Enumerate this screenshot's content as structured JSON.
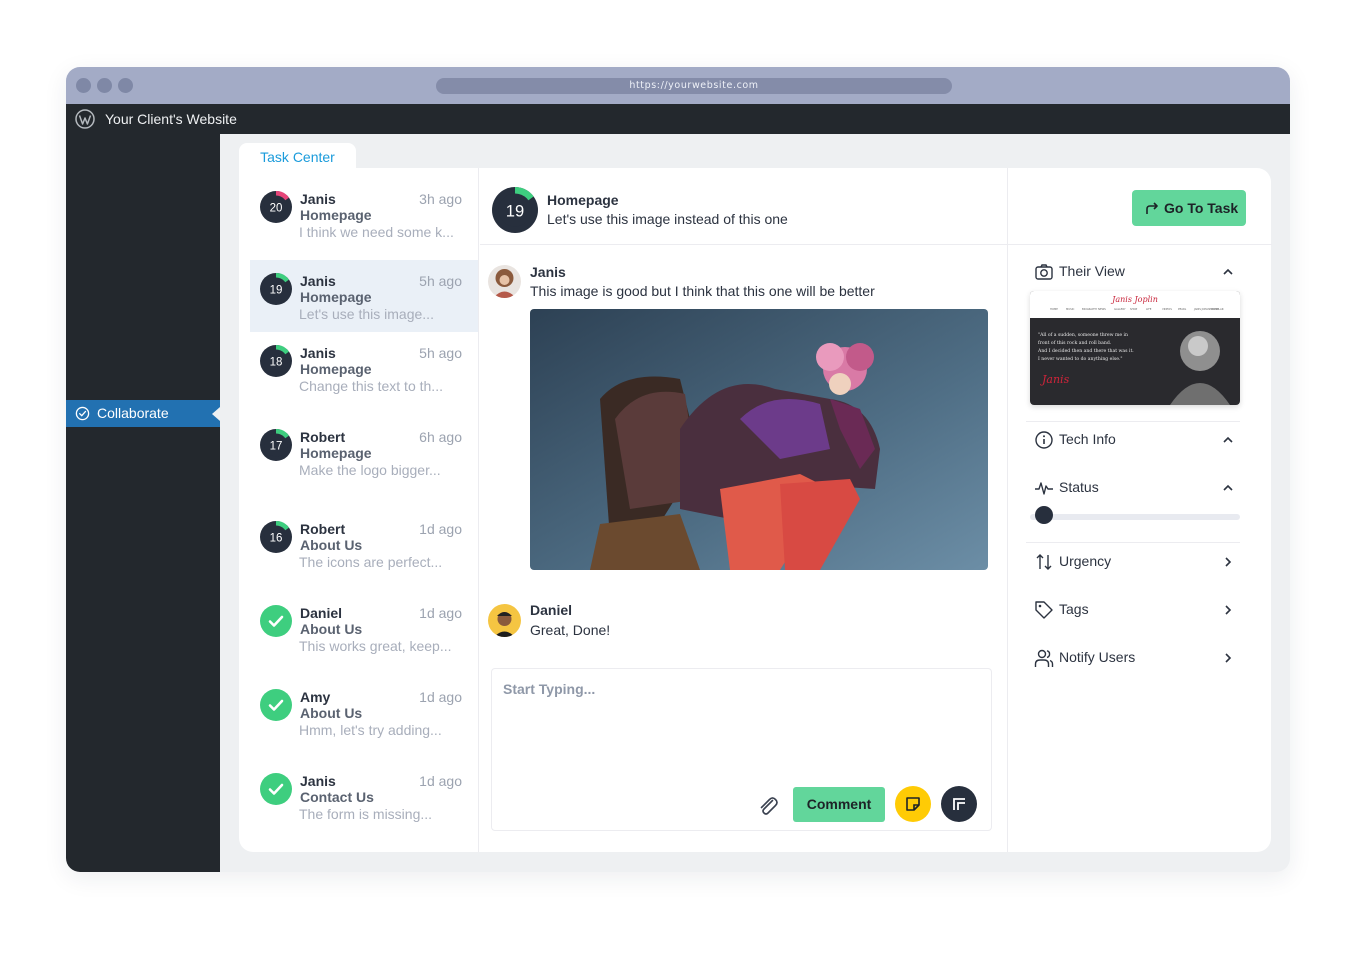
{
  "browser": {
    "url": "https://yourwebsite.com"
  },
  "wp_admin": {
    "site_name": "Your Client's Website",
    "menu_item": "Collaborate"
  },
  "tab": {
    "label": "Task Center"
  },
  "tasks": [
    {
      "number": "20",
      "name": "Janis",
      "time": "3h ago",
      "page": "Homepage",
      "excerpt": "I think we need some k...",
      "done": false,
      "progress": 0.15,
      "progress_color": "#e64579"
    },
    {
      "number": "19",
      "name": "Janis",
      "time": "5h ago",
      "page": "Homepage",
      "excerpt": "Let's use this image...",
      "done": false,
      "progress": 0.15,
      "progress_color": "#3ece7f",
      "active": true
    },
    {
      "number": "18",
      "name": "Janis",
      "time": "5h ago",
      "page": "Homepage",
      "excerpt": "Change this text to th...",
      "done": false,
      "progress": 0.15,
      "progress_color": "#3ece7f"
    },
    {
      "number": "17",
      "name": "Robert",
      "time": "6h ago",
      "page": "Homepage",
      "excerpt": "Make the logo bigger...",
      "done": false,
      "progress": 0.15,
      "progress_color": "#3ece7f"
    },
    {
      "number": "16",
      "name": "Robert",
      "time": "1d ago",
      "page": "About Us",
      "excerpt": "The icons are perfect...",
      "done": false,
      "progress": 0.15,
      "progress_color": "#3ece7f"
    },
    {
      "number": "",
      "name": "Daniel",
      "time": "1d ago",
      "page": "About Us",
      "excerpt": "This works great, keep...",
      "done": true
    },
    {
      "number": "",
      "name": "Amy",
      "time": "1d ago",
      "page": "About Us",
      "excerpt": "Hmm, let's try adding...",
      "done": true
    },
    {
      "number": "",
      "name": "Janis",
      "time": "1d ago",
      "page": "Contact Us",
      "excerpt": "The form is missing...",
      "done": true
    }
  ],
  "current_task": {
    "number": "19",
    "page": "Homepage",
    "title": "Let's use this image instead of this one",
    "go_button": "Go To Task"
  },
  "messages": [
    {
      "author": "Janis",
      "text": "This image is good but I think that this one will be better"
    },
    {
      "author": "Daniel",
      "text": "Great, Done!"
    }
  ],
  "composer": {
    "placeholder": "Start Typing...",
    "value": "",
    "comment_button": "Comment"
  },
  "right_panel": {
    "their_view": "Their View",
    "thumbnail": {
      "logo": "Janis Joplin",
      "nav_items": [
        "HOME",
        "MUSIC",
        "BIOGRAPHY",
        "NEWS",
        "GALLERY",
        "SHOP",
        "LIFE",
        "VIDEOS",
        "PEARL",
        "JANIS JOPLIN SCHOLAR",
        "STORE"
      ],
      "quote_lines": [
        "\"All of a sudden, someone threw me in",
        "front of this rock and roll band.",
        "And I decided then and there that was it.",
        "I never wanted to do anything else.\""
      ],
      "signature": "Janis"
    },
    "tech_info": "Tech Info",
    "status": "Status",
    "status_level": 0.05,
    "urgency": "Urgency",
    "tags": "Tags",
    "notify_users": "Notify Users"
  },
  "colors": {
    "accent": "#1a9bdb",
    "green": "#62d69b",
    "done": "#3ece7f",
    "dark": "#272f3d",
    "wp_blue": "#2271b1",
    "note": "#ffcb05"
  }
}
